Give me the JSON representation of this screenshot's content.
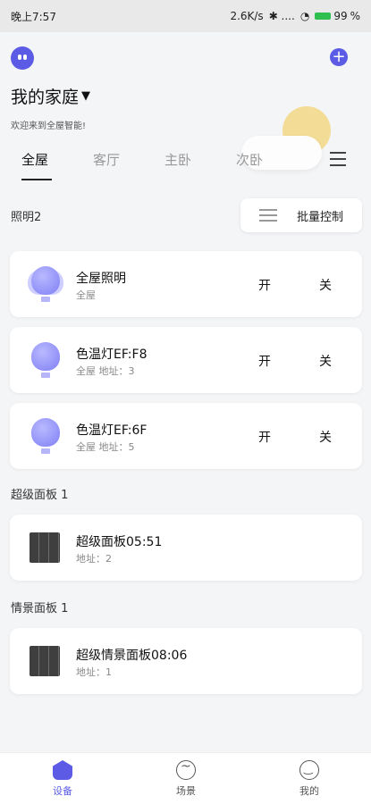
{
  "status": {
    "time": "晚上7:57",
    "net": "2.6K/s",
    "icons": "✱ ....",
    "battery": "99"
  },
  "header": {
    "title": "我的家庭",
    "welcome": "欢迎来到全屋智能!"
  },
  "tabs": [
    "全屋",
    "客厅",
    "主卧",
    "次卧"
  ],
  "lighting": {
    "label": "照明2",
    "batch_label": "批量控制",
    "cards": [
      {
        "title": "全屋照明",
        "sub": "全屋",
        "on": "开",
        "off": "关"
      },
      {
        "title": "色温灯EF:F8",
        "sub": "全屋 地址：3",
        "on": "开",
        "off": "关"
      },
      {
        "title": "色温灯EF:6F",
        "sub": "全屋 地址：5",
        "on": "开",
        "off": "关"
      }
    ]
  },
  "super_panel": {
    "label": "超级面板 1",
    "card": {
      "title": "超级面板05:51",
      "sub": "地址：2"
    }
  },
  "scene_panel": {
    "label": "情景面板 1",
    "card": {
      "title": "超级情景面板08:06",
      "sub": "地址：1"
    }
  },
  "nav": {
    "device": "设备",
    "scene": "场景",
    "mine": "我的"
  },
  "colors": {
    "accent": "#5b5be6",
    "battery": "#2fbf4f"
  }
}
